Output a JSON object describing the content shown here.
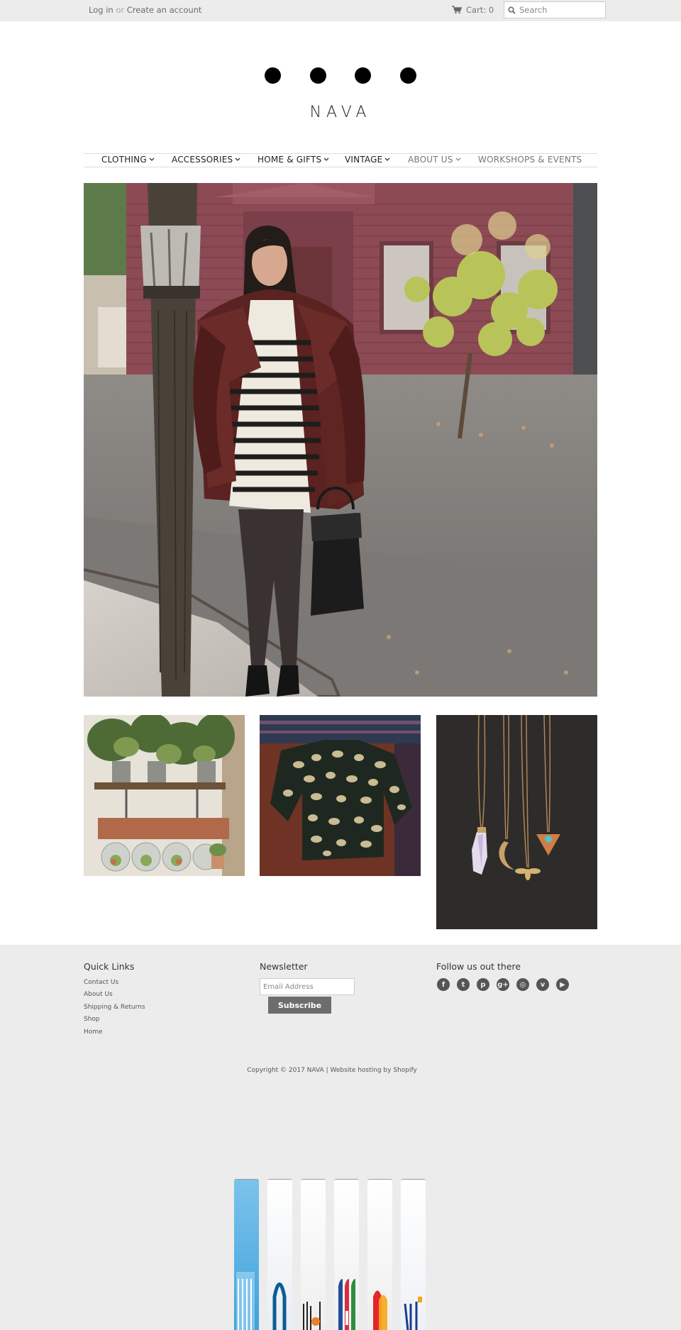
{
  "topbar": {
    "login": "Log in",
    "or": "or",
    "create_account": "Create an account",
    "cart_label": "Cart: 0",
    "search_placeholder": "Search"
  },
  "brand": {
    "wordmark": "NAVA"
  },
  "nav": {
    "items": [
      {
        "label": "CLOTHING"
      },
      {
        "label": "ACCESSORIES"
      },
      {
        "label": "HOME & GIFTS"
      },
      {
        "label": "VINTAGE"
      },
      {
        "label": "ABOUT US"
      },
      {
        "label": "WORKSHOPS & EVENTS"
      }
    ]
  },
  "footer": {
    "quick_links_title": "Quick Links",
    "quick_links": [
      "Contact Us",
      "About Us",
      "Shipping & Returns",
      "Shop",
      "Home"
    ],
    "newsletter_title": "Newsletter",
    "email_placeholder": "Email Address",
    "subscribe_label": "Subscribe",
    "follow_title": "Follow us out there",
    "social_icons": [
      "facebook-icon",
      "twitter-icon",
      "pinterest-icon",
      "google-plus-icon",
      "instagram-icon",
      "vimeo-icon",
      "youtube-icon"
    ],
    "copyright": "Copyright © 2017 NAVA | Website hosting by Shopify"
  },
  "payments": [
    "american-express-icon",
    "diners-club-icon",
    "discover-icon",
    "jcb-icon",
    "master-card-icon",
    "visa-icon"
  ],
  "colors": {
    "topbar_bg": "#ececec",
    "button_bg": "#6d6d6d",
    "page_bg": "#ffffff"
  }
}
